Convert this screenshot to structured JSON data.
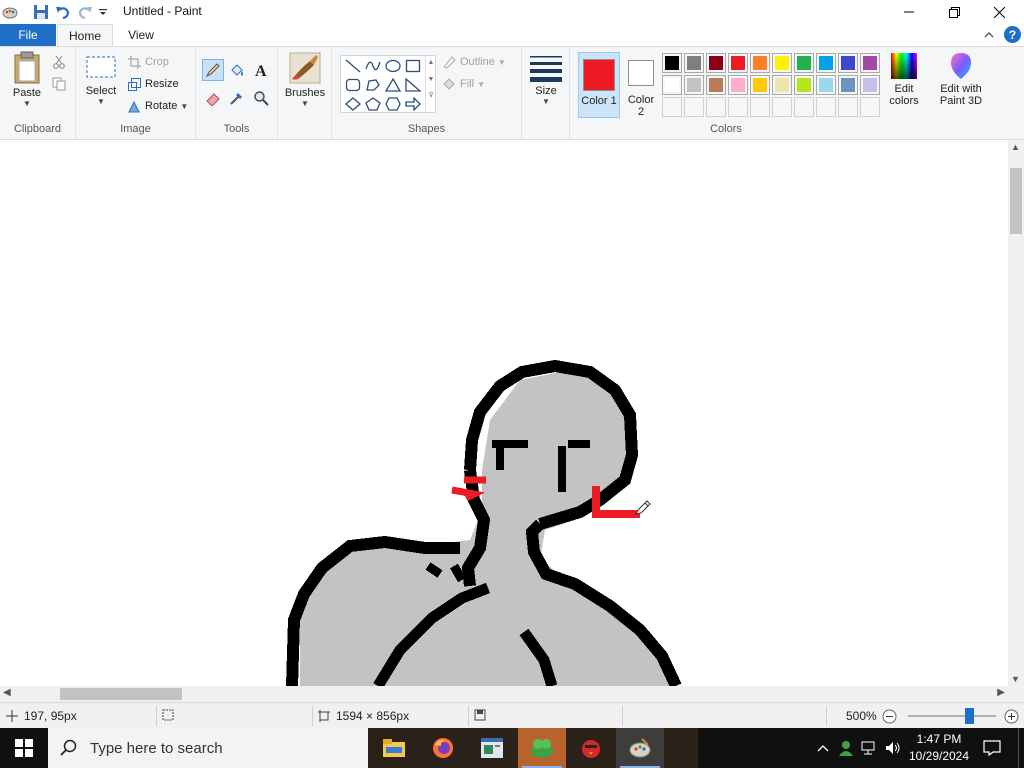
{
  "window": {
    "title": "Untitled - Paint"
  },
  "tabs": {
    "file": "File",
    "home": "Home",
    "view": "View"
  },
  "ribbon": {
    "clipboard": {
      "label": "Clipboard",
      "paste": "Paste"
    },
    "image": {
      "label": "Image",
      "select": "Select",
      "crop": "Crop",
      "resize": "Resize",
      "rotate": "Rotate"
    },
    "tools": {
      "label": "Tools"
    },
    "brushes": {
      "label": "Brushes"
    },
    "shapes": {
      "label": "Shapes",
      "outline": "Outline",
      "fill": "Fill"
    },
    "size": {
      "label": "Size"
    },
    "colors": {
      "label": "Colors",
      "color1": "Color 1",
      "color2": "Color 2",
      "color1_value": "#ed1c24",
      "color2_value": "#ffffff",
      "edit_colors": "Edit colors",
      "edit_paint3d": "Edit with Paint 3D",
      "palette_row1": [
        "#000000",
        "#7f7f7f",
        "#880015",
        "#ed1c24",
        "#ff7f27",
        "#fff200",
        "#22b14c",
        "#00a2e8",
        "#3f48cc",
        "#a349a4"
      ],
      "palette_row2": [
        "#ffffff",
        "#c3c3c3",
        "#b97a57",
        "#ffaec9",
        "#ffc90e",
        "#efe4b0",
        "#b5e61d",
        "#99d9ea",
        "#7092be",
        "#c8bfe7"
      ],
      "palette_row3_count": 10
    }
  },
  "status": {
    "cursor_pos": "197, 95px",
    "selection": "",
    "canvas_size": "1594 × 856px",
    "zoom": "500%",
    "zoom_slider_fraction": 0.72
  },
  "taskbar": {
    "search_placeholder": "Type here to search",
    "time": "1:47 PM",
    "date": "10/29/2024"
  }
}
